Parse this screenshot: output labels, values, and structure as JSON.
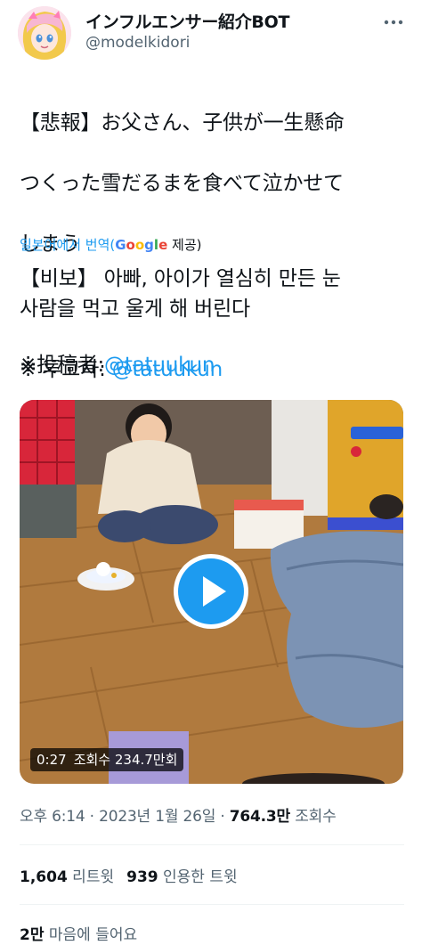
{
  "tweet": {
    "display_name": "インフルエンサー紹介BOT",
    "handle": "@modelkidori",
    "text_lines": [
      "【悲報】お父さん、子供が一生懸命",
      "つくった雪だるまを食べて泣かせて",
      "しまう"
    ],
    "poster_prefix": "※投稿者:",
    "poster_mention": "@tatuukun"
  },
  "translation": {
    "source_label": "일본어에서 번역(",
    "provider_name": "Google",
    "provider_suffix": " 제공)",
    "lines": [
      "【비보】 아빠, 아이가 열심히 만든 눈",
      "사람을 먹고 울게 해 버린다"
    ],
    "poster_prefix": "※ 투고자: ",
    "poster_mention": "@tatuukun"
  },
  "video": {
    "duration": "0:27",
    "view_text": "조회수 234.7만회"
  },
  "meta": {
    "time": "오후 6:14",
    "sep1": " · ",
    "date": "2023년 1월 26일",
    "sep2": " · ",
    "views": "764.3만",
    "views_label": " 조회수"
  },
  "stats": {
    "retweets": "1,604",
    "retweets_label": " 리트윗",
    "quotes": "939",
    "quotes_label": " 인용한 트윗",
    "likes": "2만",
    "likes_label": " 마음에 들어요"
  },
  "colors": {
    "accent": "#1d9bf0",
    "text": "#0f1419",
    "muted": "#536471",
    "divider": "#eff3f4"
  },
  "icons": {
    "more": "more-horizontal-icon",
    "play": "play-icon",
    "avatar": "profile-avatar"
  }
}
